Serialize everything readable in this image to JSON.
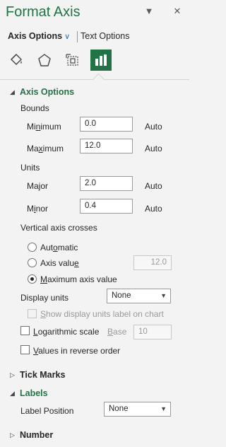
{
  "pane": {
    "title": "Format Axis",
    "dropdown_glyph": "▼",
    "close_glyph": "✕"
  },
  "tabs": {
    "selected": "Axis Options",
    "other": "Text Options"
  },
  "icons": [
    "fill-line-icon",
    "effects-icon",
    "size-properties-icon",
    "axis-options-icon"
  ],
  "sections": {
    "axis_options": "Axis Options",
    "tick_marks": "Tick Marks",
    "labels": "Labels",
    "number": "Number"
  },
  "bounds": {
    "header": "Bounds",
    "minimum_label": "Minimum",
    "minimum_value": "0.0",
    "maximum_label": "Maximum",
    "maximum_value": "12.0",
    "auto": "Auto"
  },
  "units": {
    "header": "Units",
    "major_label": "Major",
    "major_value": "2.0",
    "minor_label": "Minor",
    "minor_value": "0.4",
    "auto": "Auto"
  },
  "crosses": {
    "header": "Vertical axis crosses",
    "automatic": "Automatic",
    "axis_value": "Axis value",
    "axis_value_input": "12.0",
    "maximum": "Maximum axis value",
    "selected": "maximum"
  },
  "display_units": {
    "label": "Display units",
    "value": "None",
    "show_label": "Show display units label on chart"
  },
  "log_scale": {
    "label": "Logarithmic scale",
    "base_label": "Base",
    "base_value": "10"
  },
  "reverse": {
    "label": "Values in reverse order"
  },
  "label_position": {
    "label": "Label Position",
    "value": "None"
  },
  "colors": {
    "accent": "#217346"
  }
}
